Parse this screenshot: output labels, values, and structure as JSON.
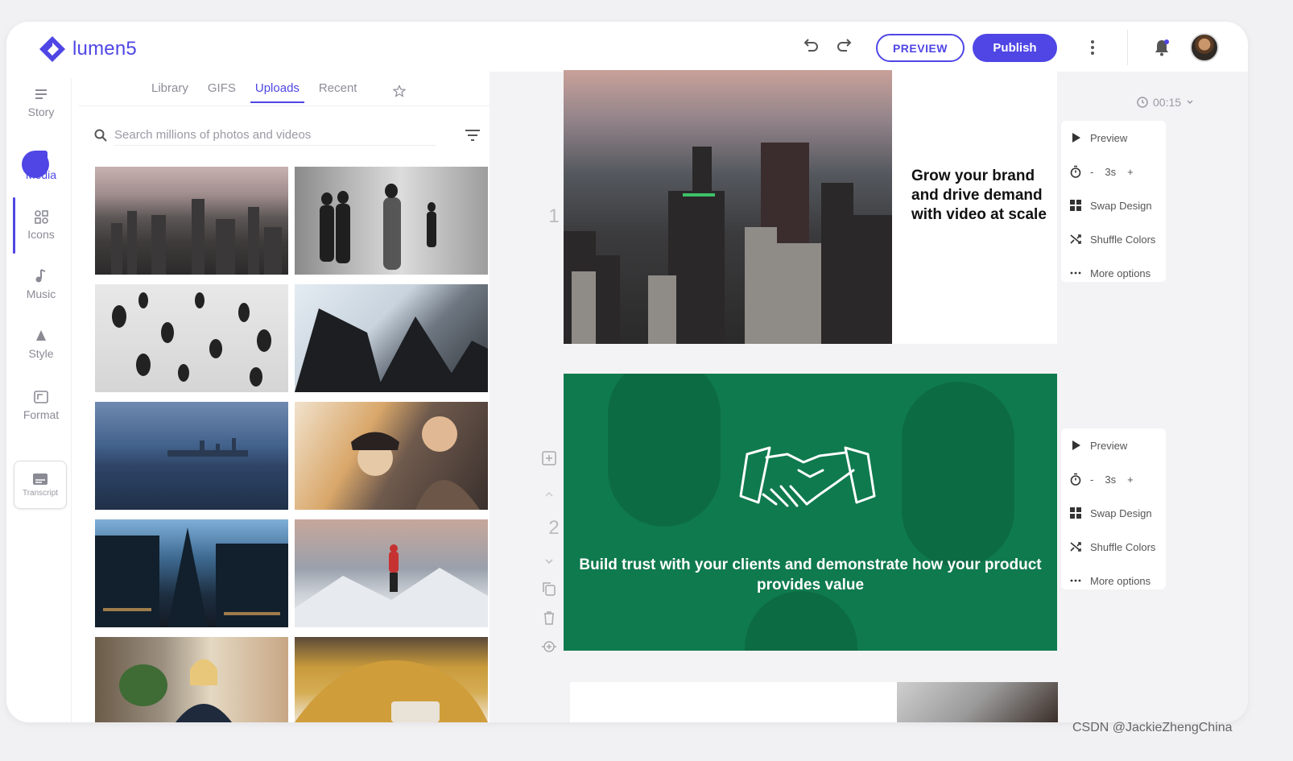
{
  "app": {
    "logo_text": "lumen5"
  },
  "header": {
    "preview_label": "PREVIEW",
    "publish_label": "Publish"
  },
  "nav": {
    "items": [
      {
        "label": "Story"
      },
      {
        "label": "Media"
      },
      {
        "label": "Icons"
      },
      {
        "label": "Music"
      },
      {
        "label": "Style"
      },
      {
        "label": "Format"
      }
    ],
    "transcript_label": "Transcript"
  },
  "media": {
    "tabs": [
      "Library",
      "GIFS",
      "Uploads",
      "Recent"
    ],
    "active_tab": "Uploads",
    "search_placeholder": "Search millions of photos and videos"
  },
  "timeline": {
    "duration": "00:15"
  },
  "slides": [
    {
      "number": "1",
      "text": "Grow your brand and drive demand with video at scale"
    },
    {
      "number": "2",
      "text": "Build trust with your clients and demonstrate how your product provides value"
    }
  ],
  "actions": {
    "preview": "Preview",
    "duration": "3s",
    "minus": "-",
    "plus": "+",
    "swap_design": "Swap Design",
    "shuffle_colors": "Shuffle Colors",
    "more_options": "More options"
  },
  "colors": {
    "accent": "#4f46e5",
    "slide_green": "#0f7a4e"
  },
  "watermark": "CSDN @JackieZhengChina"
}
